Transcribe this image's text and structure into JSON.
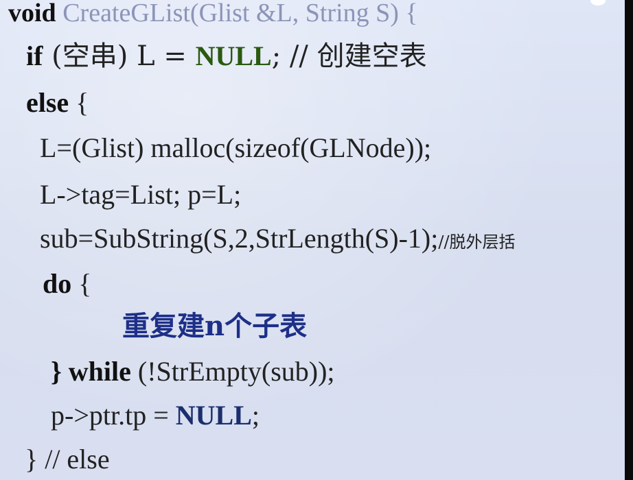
{
  "code": {
    "line1": {
      "kw": "void",
      "rest": " CreateGList(Glist &L, String S) {"
    },
    "line2": {
      "kw": "if",
      "pre": " (空串) L = ",
      "null": "NULL",
      "post": "; // 创建空表"
    },
    "line3": {
      "kw": "else",
      "rest": " {"
    },
    "line4": {
      "text": "L=(Glist) malloc(sizeof(GLNode));"
    },
    "line5": {
      "text": "L->tag=List;   p=L;"
    },
    "line6": {
      "text": "sub=SubString(S,2,StrLength(S)-1);",
      "comment": "//脱外层括"
    },
    "line7": {
      "kw": "do",
      "rest": " {"
    },
    "line8": {
      "text": "重复建n个子表"
    },
    "line9": {
      "brace": "} ",
      "kw": "while",
      "rest": " (!StrEmpty(sub));"
    },
    "line10": {
      "pre": "p->ptr.tp = ",
      "null": "NULL",
      "post": ";"
    },
    "line11": {
      "text": "} // else"
    }
  }
}
